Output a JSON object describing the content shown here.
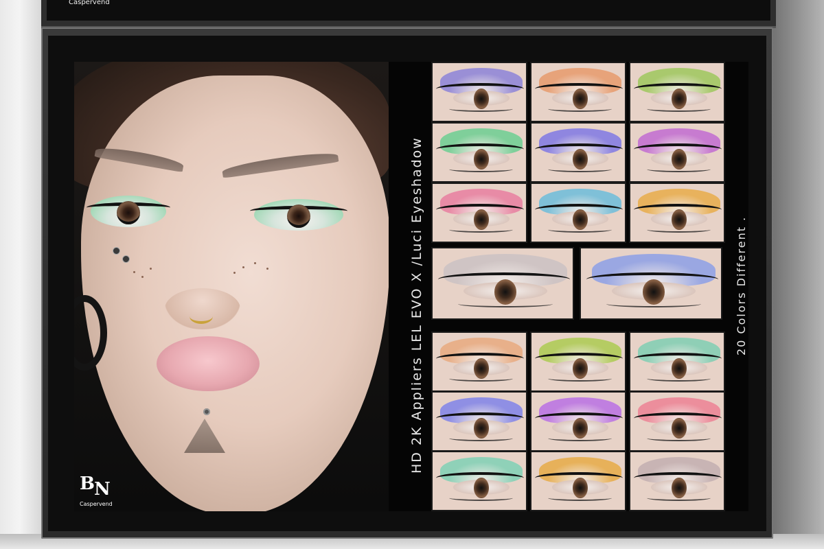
{
  "upper_board": {
    "brand": "Caspervend"
  },
  "poster": {
    "title": "HD 2K Appliers LEL EVO X /Luci Eyeshadow",
    "colors_note": "20 Colors Different .",
    "logo": "BN",
    "vendor_brand": "Caspervend"
  },
  "swatches_top": [
    {
      "color": "#9a8fd6"
    },
    {
      "color": "#e7a37a"
    },
    {
      "color": "#a9c96d"
    },
    {
      "color": "#7fcf9a"
    },
    {
      "color": "#8f86e0"
    },
    {
      "color": "#c77bd0"
    },
    {
      "color": "#e88ba6"
    },
    {
      "color": "#7fc0d8"
    },
    {
      "color": "#e8b25d"
    }
  ],
  "swatches_mid": [
    {
      "color": "#cfc4c4"
    },
    {
      "color": "#9aa7e2"
    }
  ],
  "swatches_bottom": [
    {
      "color": "#e8b08a"
    },
    {
      "color": "#b5cc63"
    },
    {
      "color": "#8fcfb6"
    },
    {
      "color": "#8f8fe4"
    },
    {
      "color": "#c07fe0"
    },
    {
      "color": "#ec8e9c"
    },
    {
      "color": "#8fd1b8"
    },
    {
      "color": "#e7b15a"
    },
    {
      "color": "#c8b4b4"
    }
  ]
}
